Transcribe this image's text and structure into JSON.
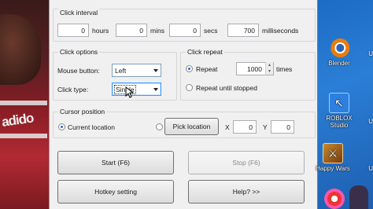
{
  "click_interval": {
    "title": "Click interval",
    "hours_value": "0",
    "hours_label": "hours",
    "mins_value": "0",
    "mins_label": "mins",
    "secs_value": "0",
    "secs_label": "secs",
    "ms_value": "700",
    "ms_label": "milliseconds"
  },
  "click_options": {
    "title": "Click options",
    "mouse_button_label": "Mouse button:",
    "mouse_button_value": "Left",
    "click_type_label": "Click type:",
    "click_type_value": "Single"
  },
  "click_repeat": {
    "title": "Click repeat",
    "repeat_label": "Repeat",
    "repeat_value": "1000",
    "times_label": "times",
    "until_stopped_label": "Repeat until stopped"
  },
  "cursor_position": {
    "title": "Cursor position",
    "current_location_label": "Current location",
    "pick_location_label": "Pick location",
    "x_label": "X",
    "x_value": "0",
    "y_label": "Y",
    "y_value": "0"
  },
  "buttons": {
    "start": "Start (F6)",
    "stop": "Stop (F6)",
    "hotkey": "Hotkey setting",
    "help": "Help? >>"
  },
  "desktop": {
    "icons": [
      {
        "label": "Blender",
        "icon": "blender-icon"
      },
      {
        "label": "ROBLOX Studio",
        "icon": "roblox-studio-icon"
      },
      {
        "label": "Happy Wars",
        "icon": "happy-wars-icon"
      }
    ],
    "edge_letter": "U"
  },
  "photo": {
    "logo_text": "adido"
  }
}
